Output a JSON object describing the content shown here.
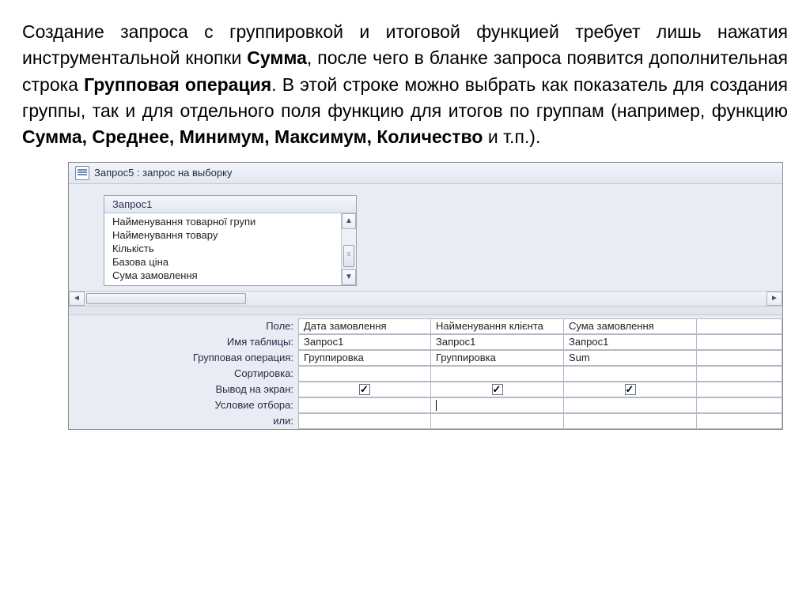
{
  "intro": {
    "p1a": "Создание запроса с группировкой и итоговой функцией требует лишь нажатия инструментальной кнопки ",
    "b1": "Сумма",
    "p1b": ", после чего в бланке запроса появится дополнительная строка ",
    "b2": "Групповая операция",
    "p1c": ". В этой строке можно выбрать как показатель для создания группы, так и для отдельного поля функцию для итогов по группам (например, функцию ",
    "b3": "Сумма, Среднее, Минимум, Максимум, Количество",
    "p1d": " и т.п.)."
  },
  "window": {
    "title": "Запрос5 : запрос на выборку",
    "source_table": {
      "name": "Запрос1",
      "fields": [
        "Найменування товарної групи",
        "Найменування товару",
        "Кількість",
        "Базова ціна",
        "Сума замовлення"
      ]
    },
    "grid": {
      "row_labels": {
        "field": "Поле:",
        "table": "Имя таблицы:",
        "group": "Групповая операция:",
        "sort": "Сортировка:",
        "show": "Вывод на экран:",
        "criteria": "Условие отбора:",
        "or": "или:"
      },
      "columns": [
        {
          "field": "Дата замовлення",
          "table": "Запрос1",
          "group": "Группировка",
          "sort": "",
          "show": true,
          "criteria": "",
          "or": ""
        },
        {
          "field": "Найменування клієнта",
          "table": "Запрос1",
          "group": "Группировка",
          "sort": "",
          "show": true,
          "criteria": "",
          "or": ""
        },
        {
          "field": "Сума замовлення",
          "table": "Запрос1",
          "group": "Sum",
          "sort": "",
          "show": true,
          "criteria": "",
          "or": ""
        }
      ]
    }
  }
}
